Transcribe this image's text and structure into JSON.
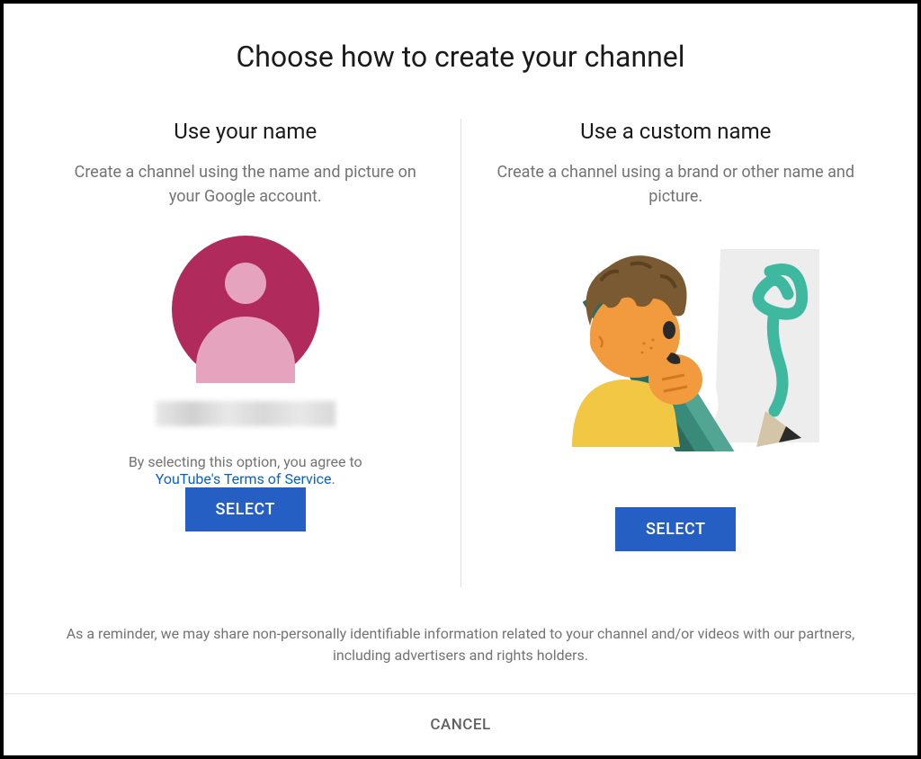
{
  "dialog": {
    "title": "Choose how to create your channel",
    "reminder": "As a reminder, we may share non-personally identifiable information related to your channel and/or videos with our partners, including advertisers and rights holders."
  },
  "options": {
    "personal": {
      "title": "Use your name",
      "description": "Create a channel using the name and picture on your Google account.",
      "terms_intro": "By selecting this option, you agree to",
      "terms_link": "YouTube's Terms of Service",
      "terms_period": ".",
      "select_label": "SELECT"
    },
    "custom": {
      "title": "Use a custom name",
      "description": "Create a channel using a brand or other name and picture.",
      "select_label": "SELECT"
    }
  },
  "footer": {
    "cancel_label": "CANCEL"
  },
  "colors": {
    "avatar_bg": "#b02a5c",
    "avatar_fg": "#e6a3bd",
    "button_primary": "#265fc4",
    "link": "#065fd4",
    "text_primary": "#1a1a1a",
    "text_secondary": "#737373"
  }
}
